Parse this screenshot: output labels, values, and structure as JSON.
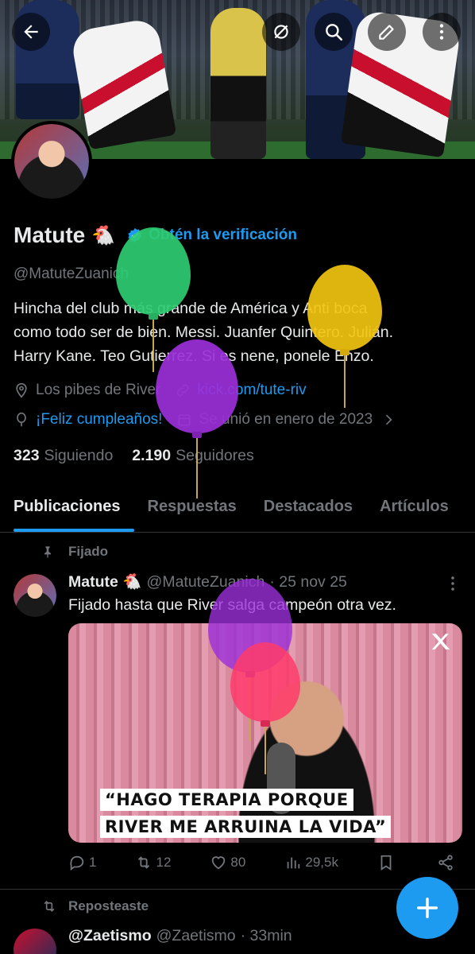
{
  "header": {
    "back_icon": "arrow-left-icon",
    "actions": [
      "sync-off-icon",
      "search-icon",
      "edit-icon",
      "more-vertical-icon"
    ]
  },
  "profile": {
    "name": "Matute",
    "name_emoji": "🐔",
    "verification_cta": "Obtén la verificación",
    "handle": "@MatuteZuanich",
    "bio_lines": [
      "Hincha del club más grande de América y Anti boca",
      "como todo ser de bien. Messi. Juanfer Quintero. Julián.",
      "Harry Kane. Teo Gutierrez. Si es nene, ponele Enzo."
    ],
    "location": "Los pibes de River",
    "website": "kick.com/tute-riv",
    "birthday": "¡Feliz cumpleaños!",
    "joined": "Se unió en enero de 2023",
    "following_count": "323",
    "following_label": "Siguiendo",
    "followers_count": "2.190",
    "followers_label": "Seguidores"
  },
  "tabs": [
    "Publicaciones",
    "Respuestas",
    "Destacados",
    "Artículos"
  ],
  "active_tab": "Publicaciones",
  "pinned_post": {
    "pinned_label": "Fijado",
    "author_name": "Matute 🐔",
    "author_handle": "@MatuteZuanich",
    "date": "· 25 nov 25",
    "text": "Fijado hasta que River salga campeón otra vez.",
    "caption_line1": "“HAGO TERAPIA PORQUE",
    "caption_line2": "RIVER ME ARRUINA LA VIDA”",
    "replies": "1",
    "reposts": "12",
    "likes": "80",
    "views": "29,5k"
  },
  "second_post": {
    "repost_label": "Reposteaste",
    "author_name": "@Zaetismo",
    "author_handle": "@Zaetismo",
    "time": "· 33min"
  },
  "colors": {
    "accent": "#1d9bf0",
    "background": "#000000",
    "muted": "#71767b",
    "balloon_green": "#2ecc71",
    "balloon_yellow": "#f1c40f",
    "balloon_purple": "#9b30d9",
    "balloon_pink": "#ff3b6b"
  }
}
